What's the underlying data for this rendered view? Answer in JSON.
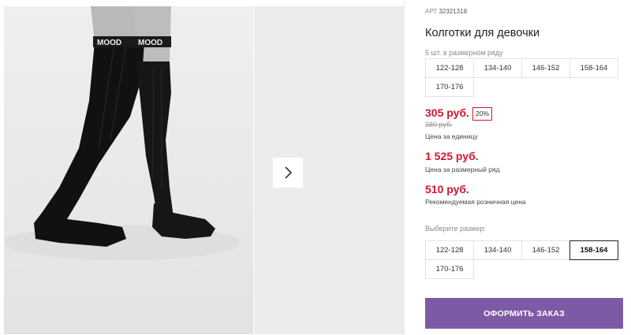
{
  "product": {
    "article_label": "АРТ",
    "article": "32321318",
    "title": "Колготки для девочки",
    "pack_info": "5 шт. в размерном ряду"
  },
  "size_row_sizes": [
    "122-128",
    "134-140",
    "146-152",
    "158-164",
    "170-176"
  ],
  "prices": {
    "unit_price": "305 руб.",
    "discount": "20%",
    "old_price": "380 руб.",
    "unit_label": "Цена за единицу",
    "row_price": "1 525 руб.",
    "row_label": "Цена за размерный ряд",
    "retail_price": "510 руб.",
    "retail_label": "Рекомендуемая розничная цена"
  },
  "size_select": {
    "label": "Выберите размер:",
    "options": [
      "122-128",
      "134-140",
      "146-152",
      "158-164",
      "170-176"
    ],
    "selected": "158-164"
  },
  "order_button": "ОФОРМИТЬ ЗАКАЗ",
  "photo": {
    "cuff_text": "MOOD"
  },
  "colors": {
    "price_red": "#d3162c",
    "button_purple": "#7d5aa6"
  }
}
